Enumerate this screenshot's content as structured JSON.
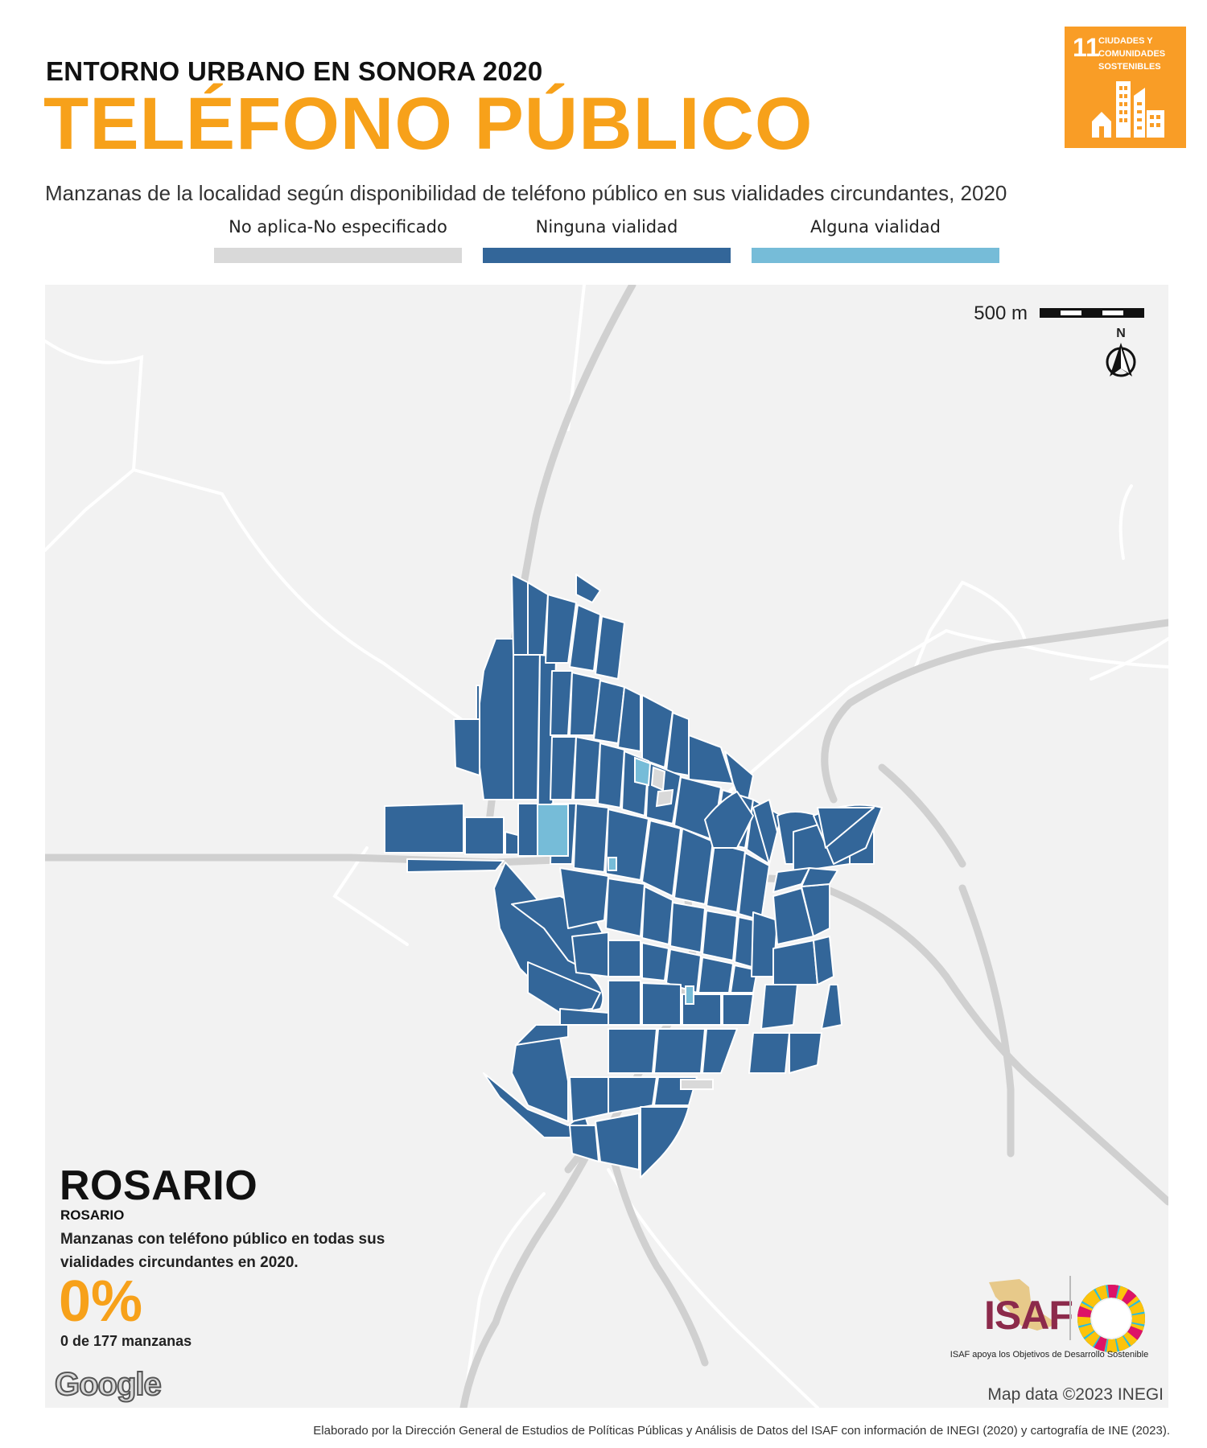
{
  "header": {
    "kicker": "ENTORNO URBANO EN SONORA 2020",
    "title": "TELÉFONO PÚBLICO",
    "subtitle": "Manzanas de la localidad según disponibilidad de teléfono público en sus vialidades circundantes, 2020"
  },
  "sdg_badge": {
    "number": "11",
    "text": "CIUDADES Y COMUNIDADES SOSTENIBLES",
    "color": "#f99d26",
    "icon": "city-buildings-icon"
  },
  "legend": [
    {
      "label": "No aplica-No especificado",
      "color": "#d9d9d9"
    },
    {
      "label": "Ninguna vialidad",
      "color": "#336699"
    },
    {
      "label": "Alguna vialidad",
      "color": "#76bcd8"
    }
  ],
  "map": {
    "scale_label": "500 m",
    "north_label": "N",
    "attribution": "Map data ©2023 INEGI",
    "provider_logo": "Google",
    "background": "#f2f2f2",
    "road_color": "#d0d0d0"
  },
  "location": {
    "name": "ROSARIO",
    "subname": "ROSARIO",
    "stat_description": "Manzanas con teléfono público en todas sus vialidades circundantes en 2020.",
    "stat_value": "0%",
    "stat_count": "0 de 177 manzanas"
  },
  "logos": {
    "isaf_word": "ISAF",
    "isaf_caption": "ISAF apoya los Objetivos de Desarrollo Sostenible",
    "sdg_wheel": "sdg-color-wheel-icon"
  },
  "footer": {
    "credit": "Elaborado por la Dirección General de Estudios de Políticas Públicas y Análisis de Datos del ISAF con información de INEGI (2020) y cartografía de INE (2023)."
  }
}
